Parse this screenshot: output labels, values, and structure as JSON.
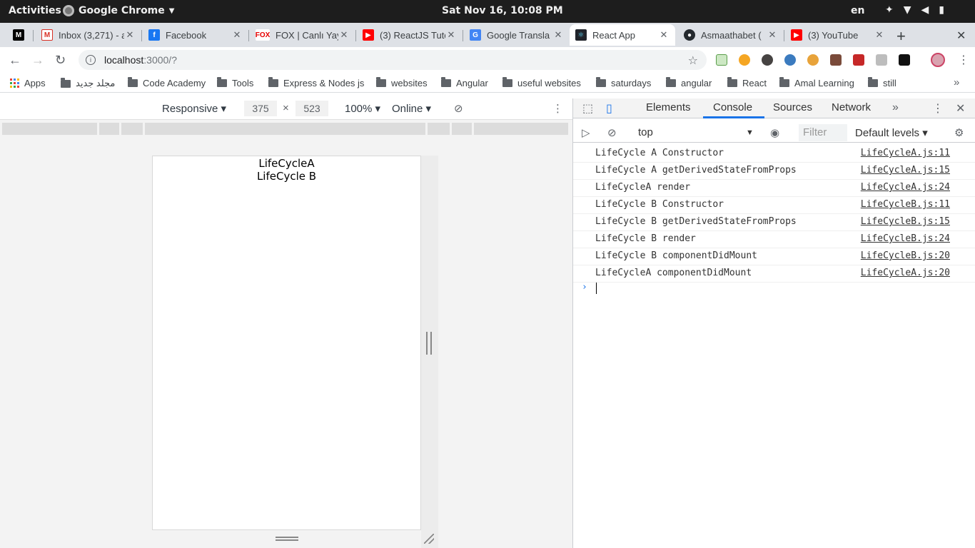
{
  "system_bar": {
    "activities": "Activities",
    "app_name": "Google Chrome",
    "clock": "Sat Nov 16, 10:08 PM",
    "language": "en"
  },
  "tabs": [
    {
      "title": "",
      "icon": "medium-icon",
      "color": "#000000"
    },
    {
      "title": "Inbox (3,271) - a",
      "icon": "gmail-icon",
      "color": "#d93025"
    },
    {
      "title": "Facebook",
      "icon": "facebook-icon",
      "color": "#1877f2"
    },
    {
      "title": "FOX | Canlı Yay",
      "icon": "fox-icon",
      "color": "#e60000"
    },
    {
      "title": "(3) ReactJS Tuto",
      "icon": "youtube-icon",
      "color": "#ff0000"
    },
    {
      "title": "Google Transla",
      "icon": "translate-icon",
      "color": "#4285f4"
    },
    {
      "title": "React App",
      "icon": "react-icon",
      "color": "#20232a"
    },
    {
      "title": "Asmaathabet (",
      "icon": "github-icon",
      "color": "#24292e"
    },
    {
      "title": "(3) YouTube",
      "icon": "youtube-icon",
      "color": "#ff0000"
    }
  ],
  "address_bar": {
    "host": "localhost",
    "path": ":3000/?"
  },
  "bookmarks": [
    {
      "label": "Apps"
    },
    {
      "label": "مجلد جديد"
    },
    {
      "label": "Code Academy"
    },
    {
      "label": "Tools"
    },
    {
      "label": "Express & Nodes js"
    },
    {
      "label": "websites"
    },
    {
      "label": "Angular"
    },
    {
      "label": "useful websites"
    },
    {
      "label": "saturdays"
    },
    {
      "label": "angular"
    },
    {
      "label": "React"
    },
    {
      "label": "Amal Learning"
    },
    {
      "label": "still"
    }
  ],
  "device_toolbar": {
    "mode": "Responsive",
    "width": "375",
    "times": "×",
    "height": "523",
    "zoom": "100%",
    "network": "Online"
  },
  "page": {
    "line1": "LifeCycleA",
    "line2": "LifeCycle B"
  },
  "devtools": {
    "tabs": [
      "Elements",
      "Console",
      "Sources",
      "Network"
    ],
    "active_tab": "Console",
    "context": "top",
    "filter_placeholder": "Filter",
    "levels": "Default levels",
    "logs": [
      {
        "message": "LifeCycle A Constructor",
        "source": "LifeCycleA.js:11"
      },
      {
        "message": "LifeCycle A getDerivedStateFromProps",
        "source": "LifeCycleA.js:15"
      },
      {
        "message": "LifeCycleA render",
        "source": "LifeCycleA.js:24"
      },
      {
        "message": "LifeCycle B Constructor",
        "source": "LifeCycleB.js:11"
      },
      {
        "message": "LifeCycle B getDerivedStateFromProps",
        "source": "LifeCycleB.js:15"
      },
      {
        "message": "LifeCycle B render",
        "source": "LifeCycleB.js:24"
      },
      {
        "message": "LifeCycle B componentDidMount",
        "source": "LifeCycleB.js:20"
      },
      {
        "message": "LifeCycleA componentDidMount",
        "source": "LifeCycleA.js:20"
      }
    ]
  }
}
